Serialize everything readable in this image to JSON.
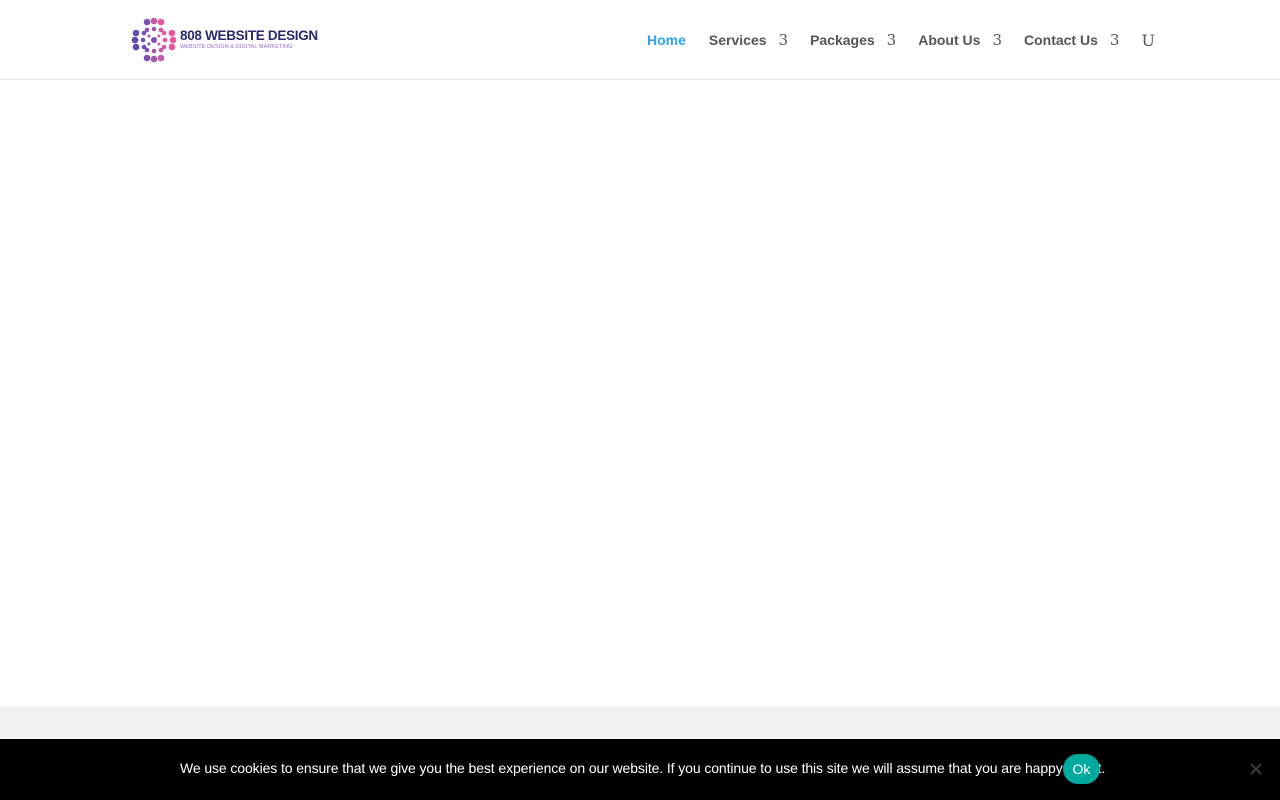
{
  "header": {
    "logo": {
      "title": "808 WEBSITE DESIGN",
      "tagline": "WEBSITE DESIGN & DIGITAL MARKETING",
      "colors": {
        "primary": "#2a2a6e",
        "accent_pink": "#e8559c",
        "accent_purple": "#7b4fb8"
      }
    },
    "nav": {
      "items": [
        {
          "label": "Home",
          "active": true,
          "has_dropdown": false
        },
        {
          "label": "Services",
          "active": false,
          "has_dropdown": true,
          "arrow": "3"
        },
        {
          "label": "Packages",
          "active": false,
          "has_dropdown": true,
          "arrow": "3"
        },
        {
          "label": "About Us",
          "active": false,
          "has_dropdown": true,
          "arrow": "3"
        },
        {
          "label": "Contact Us",
          "active": false,
          "has_dropdown": true,
          "arrow": "3"
        }
      ],
      "search_glyph": "U",
      "search_icon": "search-icon",
      "active_color": "#2ea3f2",
      "text_color": "#555555"
    }
  },
  "cookie_bar": {
    "message": "We use cookies to ensure that we give you the best experience on our website. If you continue to use this site we will assume that you are happy with it.",
    "ok_label": "Ok",
    "ok_color": "#00a99d",
    "close_icon": "close-icon"
  }
}
